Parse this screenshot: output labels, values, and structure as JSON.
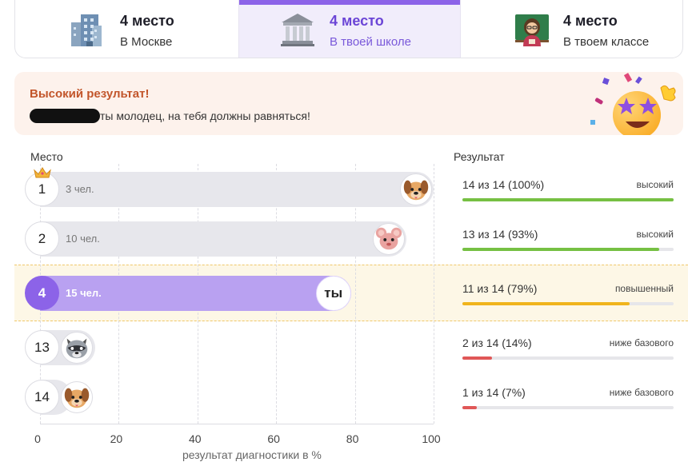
{
  "tabs": [
    {
      "title": "4 место",
      "subtitle": "В Москве",
      "icon": "city-buildings-icon"
    },
    {
      "title": "4 место",
      "subtitle": "В твоей школе",
      "icon": "school-building-icon"
    },
    {
      "title": "4 место",
      "subtitle": "В твоем классе",
      "icon": "teacher-icon"
    }
  ],
  "banner": {
    "title": "Высокий результат!",
    "text": "ты молодец, на тебя должны равняться!",
    "emoji": "star-struck-face-icon"
  },
  "table": {
    "place_header": "Место",
    "result_header": "Результат",
    "axis_title": "результат диагностики в %",
    "ticks": [
      "0",
      "20",
      "40",
      "60",
      "80",
      "100"
    ]
  },
  "colors": {
    "accent": "#8c63e8",
    "accent_light": "#b9a1f1",
    "high": "#76c043",
    "elevated": "#f0b41c",
    "below_base": "#e05757",
    "highlight_band": "#fdf7e6"
  },
  "rows": [
    {
      "rank": "1",
      "count": "3 чел.",
      "percent": 100,
      "avatar": "dog-face-icon",
      "crown": true,
      "result": "14 из 14 (100%)",
      "level": "высокий",
      "level_color": "#76c043"
    },
    {
      "rank": "2",
      "count": "10 чел.",
      "percent": 93,
      "avatar": "mouse-face-icon",
      "crown": false,
      "result": "13 из 14 (93%)",
      "level": "высокий",
      "level_color": "#76c043"
    },
    {
      "rank": "4",
      "count": "15 чел.",
      "percent": 79,
      "avatar": "ты",
      "me": true,
      "result": "11 из 14 (79%)",
      "level": "повышенный",
      "level_color": "#f0b41c"
    },
    {
      "rank": "13",
      "count": "",
      "percent": 14,
      "avatar": "raccoon-face-icon",
      "result": "2 из 14 (14%)",
      "level": "ниже базового",
      "level_color": "#e05757"
    },
    {
      "rank": "14",
      "count": "",
      "percent": 7,
      "avatar": "dog-face-icon",
      "result": "1 из 14 (7%)",
      "level": "ниже базового",
      "level_color": "#e05757"
    }
  ]
}
